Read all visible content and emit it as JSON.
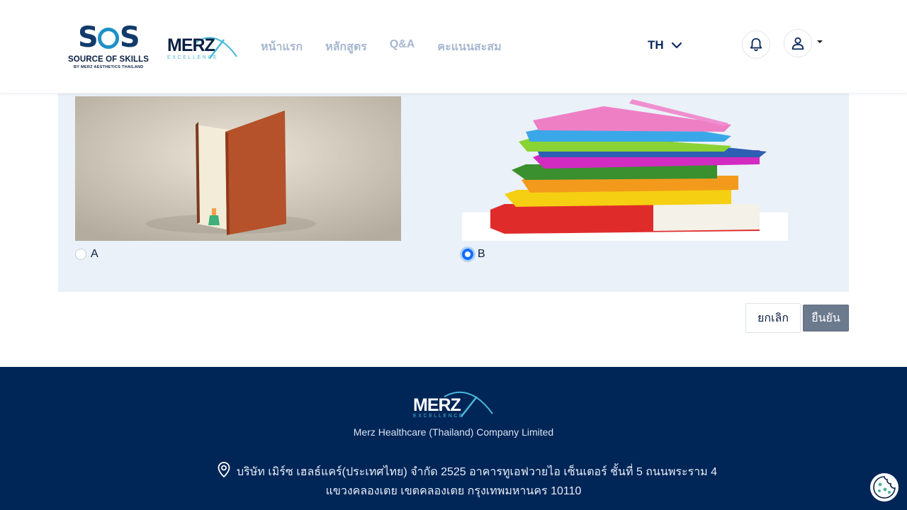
{
  "brand": {
    "sos_wordmark": "SOS",
    "sos_tagline": "SOURCE OF SKILLS",
    "sos_subline": "BY MERZ AESTHETICS THAILAND",
    "merz_wordmark": "MERZ",
    "merz_tagline": "EXCELLENCE"
  },
  "nav": {
    "items": [
      {
        "label": "หน้าแรก"
      },
      {
        "label": "หลักสูตร"
      },
      {
        "label": "Q&A"
      },
      {
        "label": "คะแนนสะสม"
      }
    ],
    "language": "TH"
  },
  "header_icons": [
    "bell-icon",
    "user-icon"
  ],
  "quiz": {
    "options": [
      {
        "label": "A",
        "image": "open-book-door-girl",
        "selected": false
      },
      {
        "label": "B",
        "image": "stack-of-colorful-books",
        "selected": true
      }
    ],
    "accent": "#0d6efd"
  },
  "actions": {
    "cancel_label": "ยกเลิก",
    "confirm_label": "ยืนยัน"
  },
  "footer": {
    "company": "Merz Healthcare (Thailand) Company Limited",
    "address_line1": "บริษัท เมิร์ซ เฮลธ์แคร์(ประเทศไทย) จำกัด 2525 อาคารทูเอฟวายไอ เซ็นเตอร์ ชั้นที่ 5 ถนนพระราม 4",
    "address_line2": "แขวงคลองเตย เขตคลองเตย กรุงเทพมหานคร 10110",
    "background": "#002557"
  }
}
